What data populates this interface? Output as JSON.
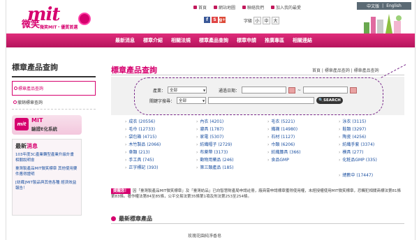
{
  "logo": {
    "main": "mit",
    "cjk": "微笑",
    "sub": "微笑MIT・優質首選"
  },
  "toplinks": [
    "首頁",
    "網站地圖",
    "聯絡我們",
    "加入我的最愛"
  ],
  "lang": {
    "zh": "中文版",
    "sep": "|",
    "en": "English"
  },
  "social": [
    "f",
    "S",
    "g+"
  ],
  "fontsize": {
    "label": "字級",
    "options": [
      "小",
      "中",
      "大"
    ]
  },
  "nav": [
    "最新消息",
    "標章介紹",
    "相關法規",
    "標章產品查詢",
    "標章申請",
    "推廣專區",
    "相關連結"
  ],
  "sidebar": {
    "title": "標章產品查詢",
    "items": [
      "標章產品查詢",
      "撤銷標章查詢"
    ],
    "banner": {
      "mit": "mit",
      "line1": "MIT",
      "line2": "驗證E化系統"
    },
    "news_title_a": "最新",
    "news_title_b": "消息",
    "news": [
      "103年度3C產業轉型產業升級計畫 相關說明會",
      "臺灣製產品MIT微笑標章 其他使用要件應得證明",
      "[紡織]MIT製品與其他各種 經濟效益報告！"
    ]
  },
  "main": {
    "title": "標章產品查詢",
    "breadcrumb": "首頁 | 標章產品查詢 | 標章產品查詢"
  },
  "search": {
    "industry_label": "產業：",
    "industry_value": "全部",
    "date_label": "通過日期：",
    "tilde": "~",
    "keyword_label": "關鍵字搜尋：",
    "keyword_scope": "全部",
    "button": "SEARCH"
  },
  "categories": [
    "成衣 (20556)",
    "內衣 (4201)",
    "毛衣 (5221)",
    "泳衣 (3115)",
    "毛巾 (12733)",
    "寢具 (1787)",
    "織襪 (14980)",
    "鞋類 (3297)",
    "袋包箱 (4715)",
    "家電 (5307)",
    "石材 (1127)",
    "陶瓷 (4256)",
    "木竹製品 (2066)",
    "紡織帽子 (2729)",
    "巾類 (6206)",
    "紡織手套 (3374)",
    "傘類 (213)",
    "布蓆帶 (3173)",
    "紡織簾具 (366)",
    "模具 (277)",
    "手工具 (745)",
    "動物用藥品 (246)",
    "食品GMP",
    "化粧品GMP (335)",
    "正字標記 (393)",
    "第三類產品 (185)",
    "",
    "",
    "",
    "",
    "",
    "總數中 (17447)"
  ],
  "alert": {
    "tag": "提醒您！",
    "text": "因「臺灣製產品MIT微笑標章」及「臺灣紡品」已向智慧財產局申請註冊，廠商需申請標章獲得使用權，未經授權使用MIT微笑標章，恐觸犯相關商標法第81條第83條。著作權法第84至85條，公平交易法第35條第1項及刑法第253至254條。",
    "red": "MIT微笑標章"
  },
  "latest": {
    "title": "最新標章產品",
    "item": "玫瑰花園純淨香皂"
  }
}
